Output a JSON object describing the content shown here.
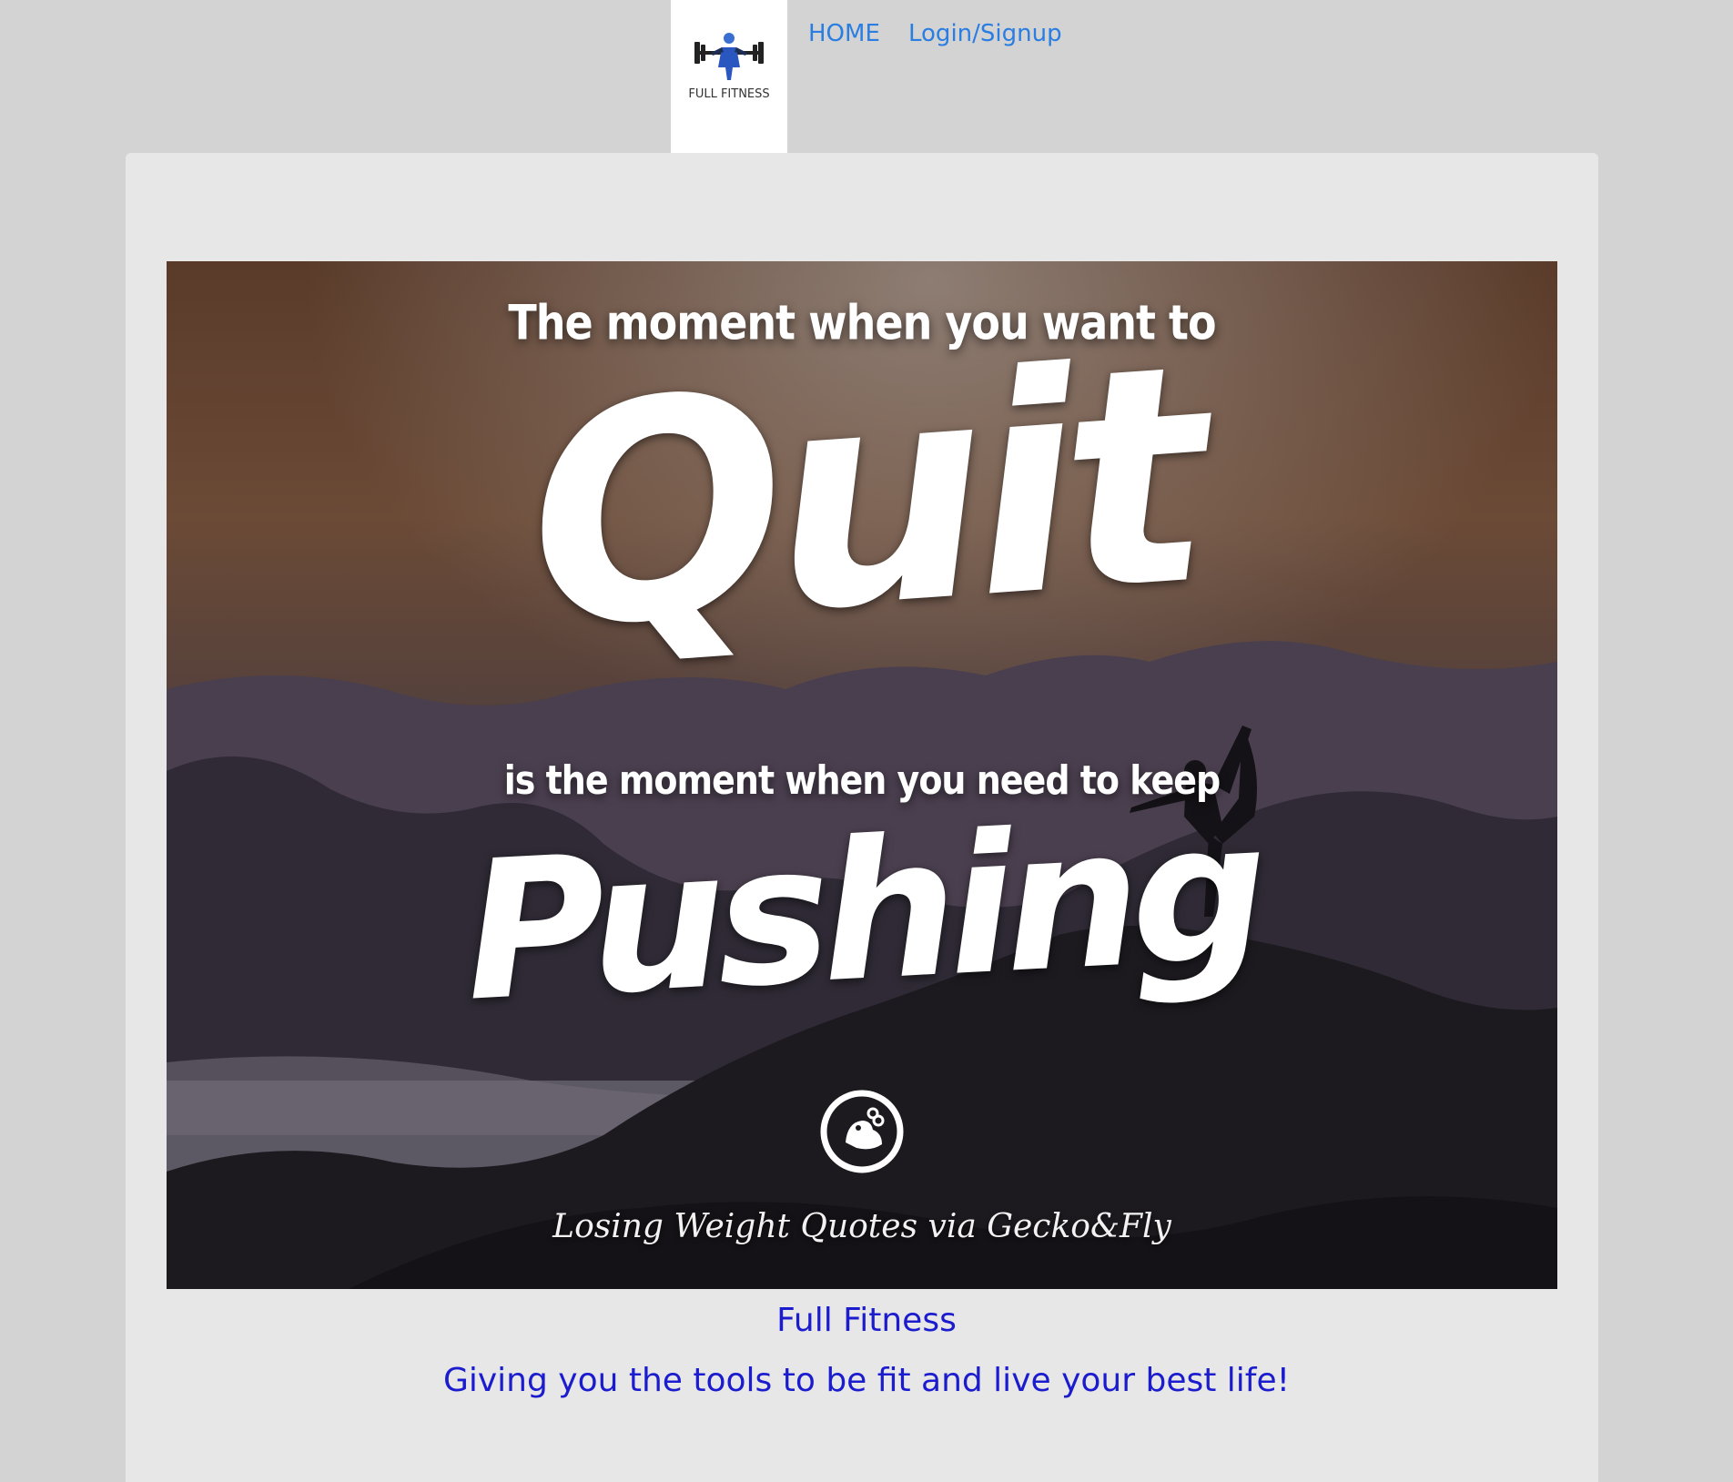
{
  "header": {
    "logo_text": "FULL FITNESS",
    "nav": {
      "home_label": "HOME",
      "login_label": "Login/Signup"
    }
  },
  "hero": {
    "line1": "The moment when you want to",
    "quit_word": "Quit",
    "line2": "is the moment when you need to keep",
    "pushing_word": "Pushing",
    "credit": "Losing Weight Quotes via Gecko&Fly"
  },
  "caption": {
    "title": "Full Fitness",
    "subtitle": "Giving you the tools to be fit and live your best life!"
  },
  "colors": {
    "page_background": "#d3d3d3",
    "card_background": "#e7e7e7",
    "nav_link": "#2a7de1",
    "caption_text": "#1c1ccf"
  },
  "icons": {
    "logo": "weightlifter-barbell-icon",
    "emblem": "bird-emblem-icon"
  }
}
